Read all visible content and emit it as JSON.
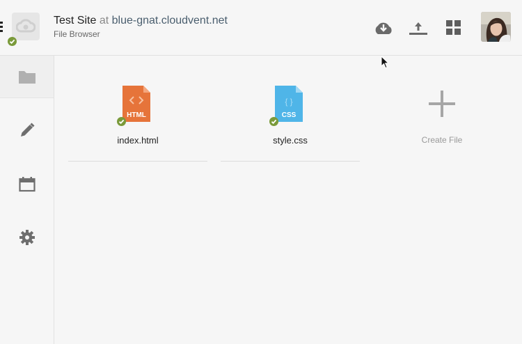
{
  "header": {
    "site_name": "Test Site",
    "at_word": "at",
    "host": "blue-gnat.cloudvent.net",
    "section": "File Browser"
  },
  "icons": {
    "menu": "menu-dots-icon",
    "site_logo": "cloud-logo-icon",
    "status": "check-badge-icon",
    "download": "cloud-download-icon",
    "upload": "upload-icon",
    "grid": "grid-view-icon",
    "folder": "folder-icon",
    "edit": "pencil-icon",
    "calendar": "calendar-icon",
    "settings": "gear-icon",
    "add": "plus-icon"
  },
  "files": [
    {
      "name": "index.html",
      "type_label": "HTML",
      "glyph": "< >",
      "color": "#e6743a"
    },
    {
      "name": "style.css",
      "type_label": "CSS",
      "glyph": "{ }",
      "color": "#4fb5e8"
    }
  ],
  "create_file": {
    "label": "Create File"
  },
  "colors": {
    "status_green": "#7a9a3a",
    "icon_gray": "#6a6a6a",
    "background": "#f6f6f6"
  }
}
